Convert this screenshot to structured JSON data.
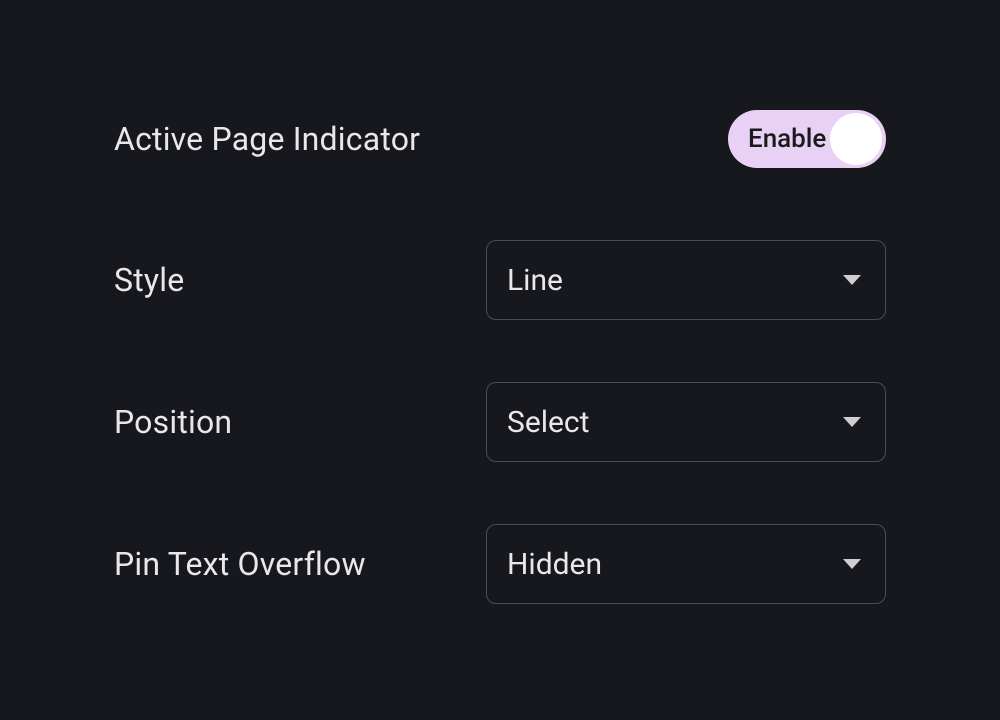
{
  "settings": {
    "activePageIndicator": {
      "label": "Active Page Indicator",
      "toggleLabel": "Enable",
      "enabled": true
    },
    "style": {
      "label": "Style",
      "value": "Line"
    },
    "position": {
      "label": "Position",
      "value": "Select"
    },
    "pinTextOverflow": {
      "label": "Pin Text Overflow",
      "value": "Hidden"
    }
  }
}
